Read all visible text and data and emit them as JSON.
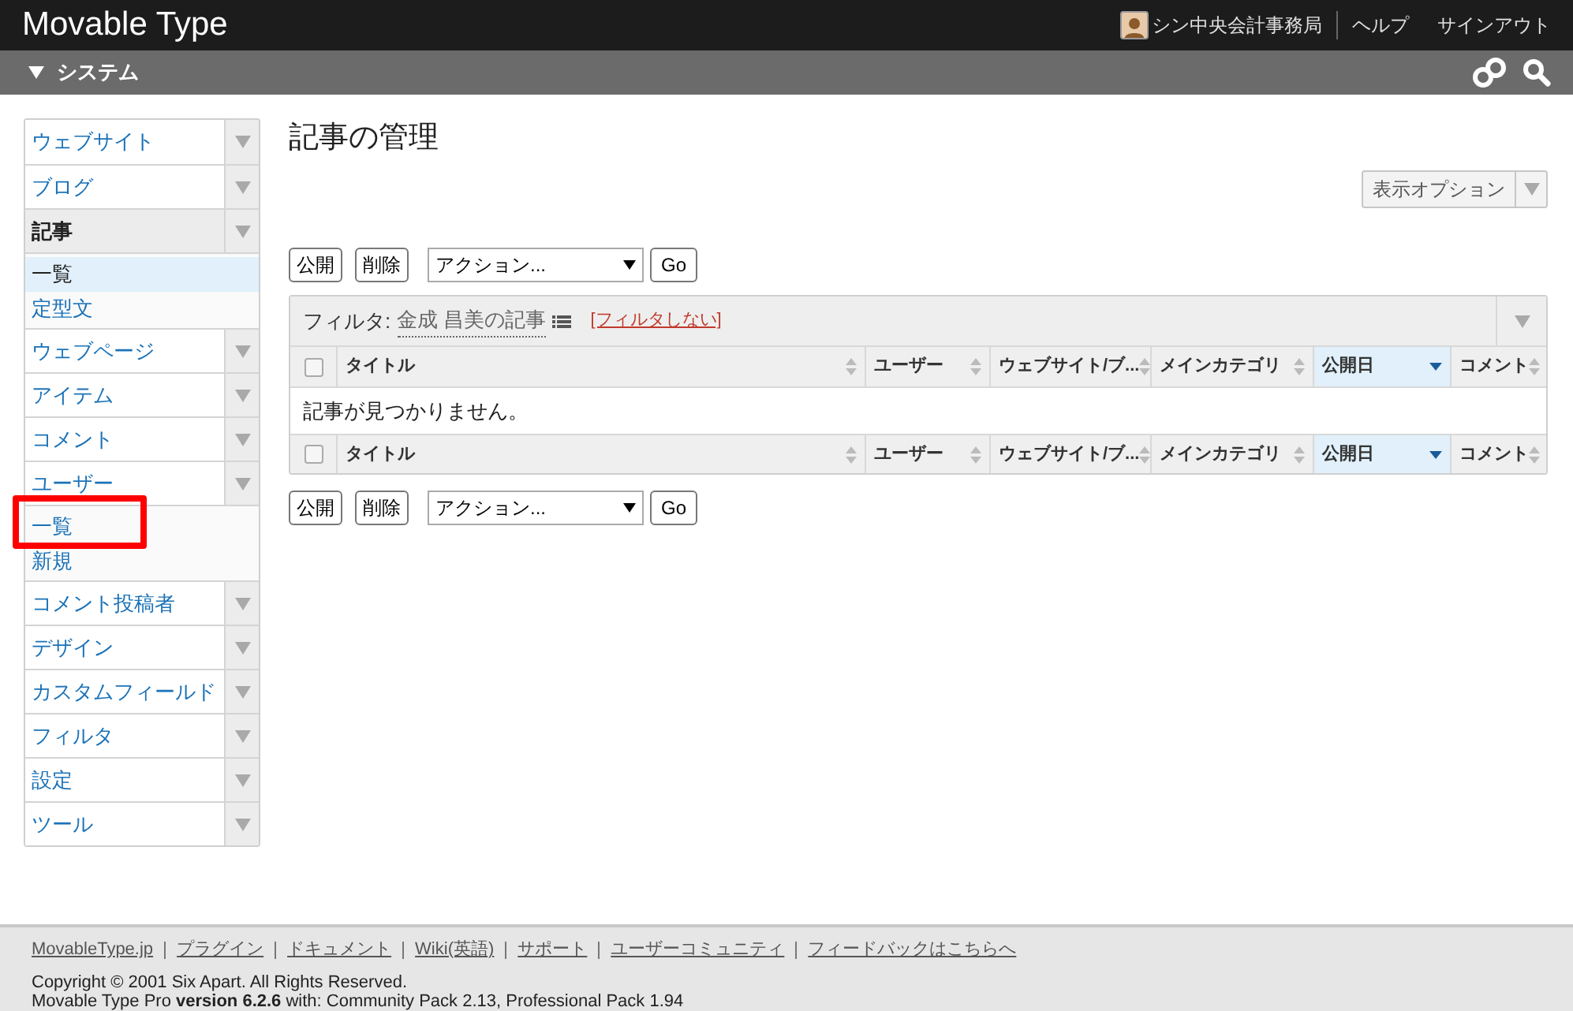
{
  "header": {
    "logo": "Movable Type",
    "user": "シン中央会計事務局",
    "links": [
      "ヘルプ",
      "サインアウト"
    ]
  },
  "scope_bar": {
    "label": "システム"
  },
  "sidebar": {
    "items": [
      {
        "label": "ウェブサイト",
        "selected": false
      },
      {
        "label": "ブログ",
        "selected": false
      },
      {
        "label": "記事",
        "selected": true,
        "children": [
          {
            "label": "一覧",
            "selected": true
          },
          {
            "label": "定型文",
            "selected": false
          }
        ]
      },
      {
        "label": "ウェブページ",
        "selected": false
      },
      {
        "label": "アイテム",
        "selected": false
      },
      {
        "label": "コメント",
        "selected": false
      },
      {
        "label": "ユーザー",
        "selected": false,
        "children": [
          {
            "label": "一覧",
            "selected": false
          },
          {
            "label": "新規",
            "selected": false
          }
        ]
      },
      {
        "label": "コメント投稿者",
        "selected": false
      },
      {
        "label": "デザイン",
        "selected": false
      },
      {
        "label": "カスタムフィールド",
        "selected": false
      },
      {
        "label": "フィルタ",
        "selected": false
      },
      {
        "label": "設定",
        "selected": false
      },
      {
        "label": "ツール",
        "selected": false
      }
    ]
  },
  "page_title": "記事の管理",
  "display_options": "表示オプション",
  "actions_top": {
    "buttons": [
      "公開",
      "削除"
    ],
    "select": "アクション...",
    "go": "Go"
  },
  "filter": {
    "label": "フィルタ:",
    "name": "金成 昌美の記事",
    "clear": "[フィルタしない]"
  },
  "table": {
    "header_checked": false,
    "footer_checked": false,
    "columns": [
      {
        "label": "タイトル",
        "selected": false
      },
      {
        "label": "ユーザー",
        "selected": false
      },
      {
        "label": "ウェブサイト/ブ...",
        "selected": false
      },
      {
        "label": "メインカテゴリ",
        "selected": false
      },
      {
        "label": "公開日",
        "selected": true
      },
      {
        "label": "コメント",
        "selected": false
      }
    ],
    "empty_message": "記事が見つかりません。",
    "footer_columns": [
      {
        "label": "タイトル",
        "selected": false
      },
      {
        "label": "ユーザー",
        "selected": false
      },
      {
        "label": "ウェブサイト/ブ...",
        "selected": false
      },
      {
        "label": "メインカテゴリ",
        "selected": false
      },
      {
        "label": "公開日",
        "selected": true
      },
      {
        "label": "コメント",
        "selected": false
      }
    ]
  },
  "actions_bottom": {
    "buttons": [
      "公開",
      "削除"
    ],
    "select": "アクション...",
    "go": "Go"
  },
  "footer": {
    "links": [
      "MovableType.jp",
      "プラグイン",
      "ドキュメント",
      "Wiki(英語)",
      "サポート",
      "ユーザーコミュニティ",
      "フィードバックはこちらへ"
    ],
    "copyright": "Copyright © 2001 Six Apart. All Rights Reserved.",
    "version": "Movable Type Pro **version 6.2.6** with: Community Pack 2.13, Professional Pack 1.94"
  }
}
